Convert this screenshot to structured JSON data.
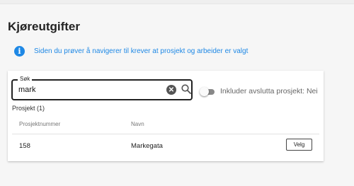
{
  "page": {
    "title": "Kjøreutgifter"
  },
  "info": {
    "icon": "info-icon",
    "glyph": "i",
    "message": "Siden du prøver å navigerer til krever at prosjekt og arbeider er valgt"
  },
  "search": {
    "legend": "Søk",
    "value": "mark",
    "clear_icon": "clear-icon",
    "clear_glyph": "✕",
    "search_icon": "search-icon"
  },
  "toggle": {
    "label": "Inkluder avslutta prosjekt: Nei",
    "checked": false
  },
  "results": {
    "section_label": "Prosjekt (1)",
    "columns": [
      "Prosjektnummer",
      "Navn"
    ],
    "rows": [
      {
        "number": "158",
        "name": "Markegata",
        "action": "Velg"
      }
    ]
  },
  "colors": {
    "accent": "#1e88e5",
    "text": "#212121",
    "muted": "#777777"
  }
}
